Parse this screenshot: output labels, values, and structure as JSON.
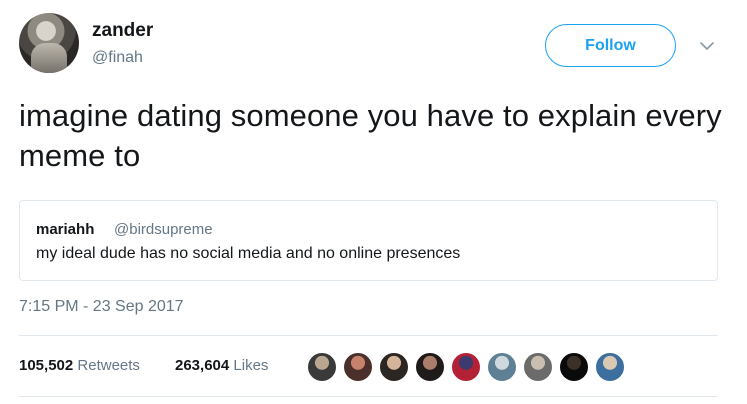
{
  "author": {
    "name": "zander",
    "handle": "@finah"
  },
  "follow_button": {
    "label": "Follow"
  },
  "tweet": {
    "text": "imagine dating someone you have to explain every meme to",
    "timestamp": "7:15 PM - 23 Sep 2017"
  },
  "quoted_tweet": {
    "name": "mariahh",
    "handle": "@birdsupreme",
    "text": "my ideal dude has no social media and no online presences"
  },
  "stats": {
    "retweets_count": "105,502",
    "retweets_label": "Retweets",
    "likes_count": "263,604",
    "likes_label": "Likes"
  },
  "liker_avatars": [
    {
      "color_a": "#3a3a3a",
      "color_b": "#b9a88f"
    },
    {
      "color_a": "#4a2f2a",
      "color_b": "#c7826b"
    },
    {
      "color_a": "#2c2622",
      "color_b": "#d4b59a"
    },
    {
      "color_a": "#1f1b1a",
      "color_b": "#a97d6a"
    },
    {
      "color_a": "#b22234",
      "color_b": "#3c3b6e"
    },
    {
      "color_a": "#5e7f94",
      "color_b": "#cfd8dc"
    },
    {
      "color_a": "#6b6b6b",
      "color_b": "#c9bfb0"
    },
    {
      "color_a": "#0a0a0a",
      "color_b": "#3b3128"
    },
    {
      "color_a": "#3c6e9e",
      "color_b": "#d9c9b3"
    }
  ],
  "colors": {
    "accent": "#1da1f2",
    "secondary_text": "#657786",
    "primary_text": "#14171a",
    "border": "#e1e8ed"
  },
  "icons": {
    "menu": "chevron-down-icon"
  }
}
